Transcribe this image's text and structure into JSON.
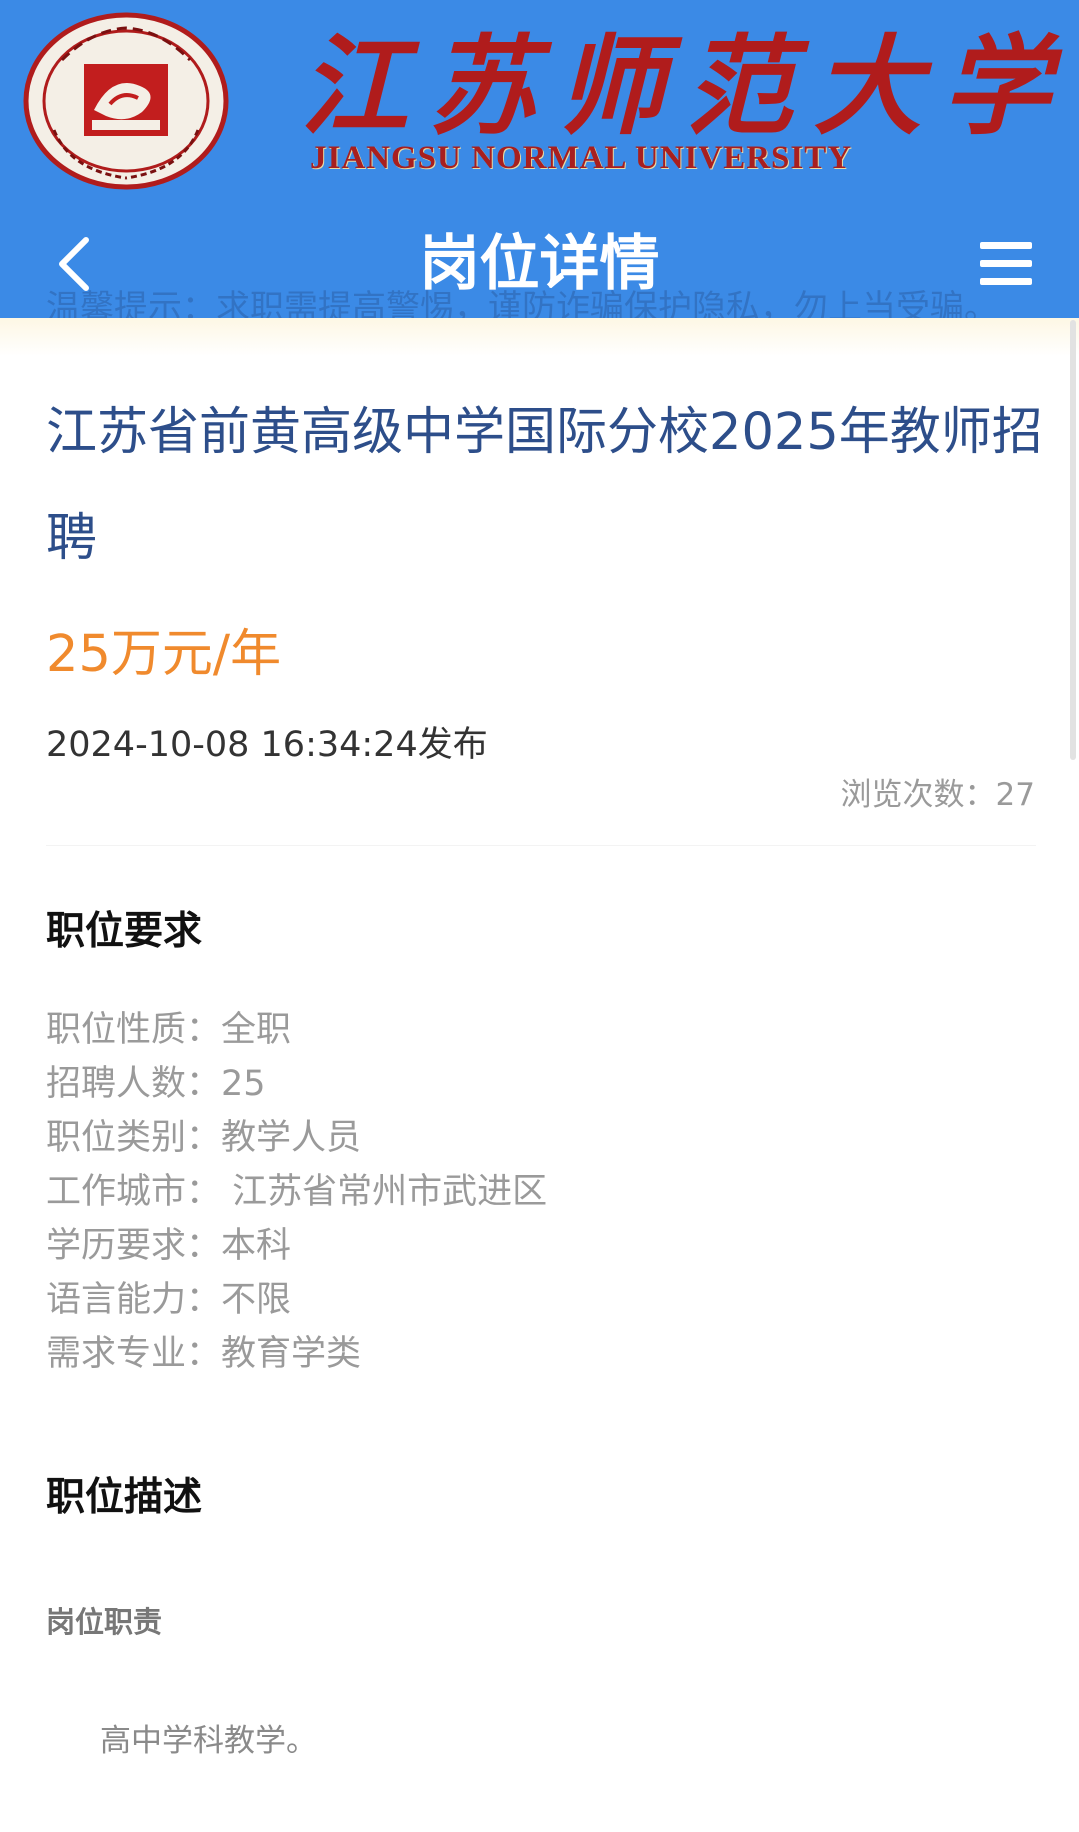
{
  "header": {
    "brand_cn": [
      "江",
      "苏",
      "师",
      "范",
      "大",
      "学"
    ],
    "brand_en": "JIANGSU  NORMAL  UNIVERSITY",
    "ghost_notice": "温馨提示：求职需提高警惕，谨防诈骗保护隐私，勿上当受骗。",
    "title": "岗位详情",
    "back_icon": "chevron-left-icon",
    "menu_icon": "hamburger-menu-icon",
    "colors": {
      "bar": "#3b8ae6",
      "brand_red": "#b01c1c"
    }
  },
  "job": {
    "title": "江苏省前黄高级中学国际分校2025年教师招聘",
    "salary": "25万元/年",
    "published": "2024-10-08 16:34:24发布",
    "views_label": "浏览次数：",
    "views_count": "27"
  },
  "requirements": {
    "heading": "职位要求",
    "items": [
      {
        "label": "职位性质：",
        "value": "全职"
      },
      {
        "label": "招聘人数：",
        "value": "25"
      },
      {
        "label": "职位类别：",
        "value": "教学人员"
      },
      {
        "label": "工作城市：",
        "value": " 江苏省常州市武进区"
      },
      {
        "label": "学历要求：",
        "value": "本科"
      },
      {
        "label": "语言能力：",
        "value": "不限"
      },
      {
        "label": "需求专业：",
        "value": "教育学类"
      }
    ]
  },
  "description": {
    "heading": "职位描述",
    "subheading": "岗位职责",
    "text": "高中学科教学。"
  }
}
